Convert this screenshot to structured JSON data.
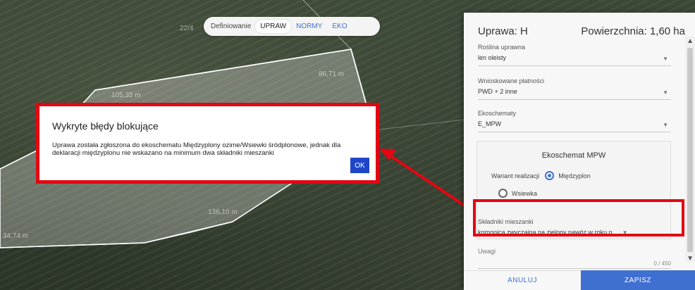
{
  "map": {
    "labels": [
      "22/4",
      "86,71 m",
      "105,35 m",
      "136,10 m",
      "34,74 m"
    ]
  },
  "mode_bar": {
    "label": "Definiowanie",
    "tabs": [
      "UPRAW",
      "NORMY",
      "EKO"
    ],
    "active": "UPRAW"
  },
  "dialog": {
    "title": "Wykryte błędy blokujące",
    "message": "Uprawa została zgłoszona do ekoschematu Międzyplony ozime/Wsiewki śródplonowe, jednak dla deklaracji międzyplonu nie wskazano na minimum dwa składniki mieszanki",
    "ok_label": "OK"
  },
  "panel": {
    "crop_title": "Uprawa: H",
    "area_title": "Powierzchnia: 1,60 ha",
    "fields": [
      {
        "label": "Roślina uprawna",
        "value": "len oleisty"
      },
      {
        "label": "Wnioskowane płatności",
        "value": "PWD + 2 inne"
      },
      {
        "label": "Ekoschematy",
        "value": "E_MPW"
      }
    ],
    "eco": {
      "title": "Ekoschemat MPW",
      "variant_label": "Wariant realizacji",
      "option_1": "Międzyplon",
      "option_2": "Wsiewka",
      "selected": "Międzyplon"
    },
    "components": {
      "label": "Składniki mieszanki",
      "value": "komonica zwyczajna na zielony nawóz w roku n..."
    },
    "notes": {
      "label": "Uwagi",
      "counter": "0 / 450"
    },
    "cancel_label": "ANULUJ",
    "save_label": "ZAPISZ"
  },
  "colors": {
    "highlight": "#e30613",
    "accent": "#3f6fd1",
    "ok_button": "#1f46c9"
  }
}
